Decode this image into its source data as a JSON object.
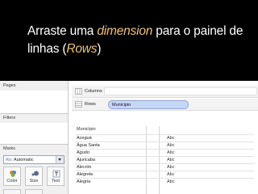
{
  "banner": {
    "part1": "Arraste uma ",
    "highlight": "dimension",
    "part2": " para o painel de linhas (",
    "highlight2": "Rows",
    "part3": ")"
  },
  "left_panel": {
    "pages_label": "Pages",
    "filters_label": "Filters",
    "marks_label": "Marks",
    "mark_type": {
      "prefix": "Abc",
      "value": "Automatic"
    },
    "mark_buttons": [
      {
        "label": "Color",
        "icon": "color-icon"
      },
      {
        "label": "Size",
        "icon": "size-icon"
      },
      {
        "label": "Text",
        "icon": "text-icon"
      }
    ]
  },
  "shelves": {
    "columns_label": "Columns",
    "rows_label": "Rows",
    "rows_pill": "Municipio"
  },
  "table": {
    "header": "Município",
    "rows": [
      {
        "city": "Aceguá",
        "value": "Abc"
      },
      {
        "city": "Água Santa",
        "value": "Abc"
      },
      {
        "city": "Agudo",
        "value": "Abc"
      },
      {
        "city": "Ajuricaba",
        "value": "Abc"
      },
      {
        "city": "Alecrim",
        "value": "Abc"
      },
      {
        "city": "Alegrete",
        "value": "Abc"
      },
      {
        "city": "Alegria",
        "value": "Abc"
      }
    ]
  },
  "colors": {
    "banner_bg": "#000000",
    "highlight": "#f2c27d",
    "pill_bg": "#c6d6f5"
  }
}
